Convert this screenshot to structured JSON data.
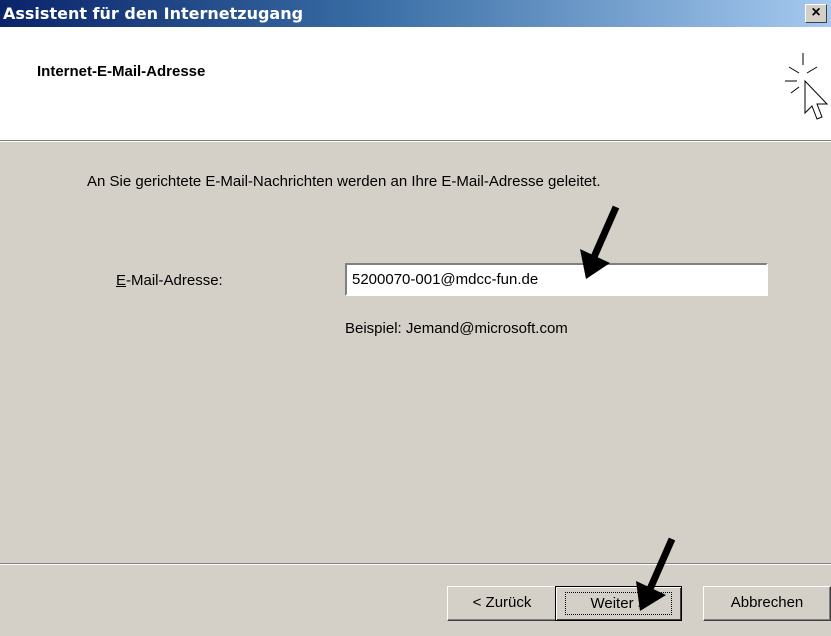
{
  "window": {
    "title": "Assistent für den Internetzugang",
    "close_glyph": "×"
  },
  "header": {
    "title": "Internet-E-Mail-Adresse",
    "icon": "wizard-cursor-icon"
  },
  "main": {
    "intro": "An Sie gerichtete E-Mail-Nachrichten werden an Ihre E-Mail-Adresse geleitet.",
    "email_label": "E-Mail-Adresse:",
    "email_label_mnemonic": "E",
    "email_value": "5200070-001@mdcc-fun.de",
    "example": "Beispiel: Jemand@microsoft.com"
  },
  "buttons": {
    "back": "< Zurück",
    "next": "Weiter >",
    "cancel": "Abbrechen"
  },
  "annotations": {
    "arrow_icon": "black-arrow-icon"
  },
  "colors": {
    "titlebar_start": "#0a246a",
    "titlebar_end": "#a6caf0",
    "dialog_face": "#d4d0c8"
  }
}
